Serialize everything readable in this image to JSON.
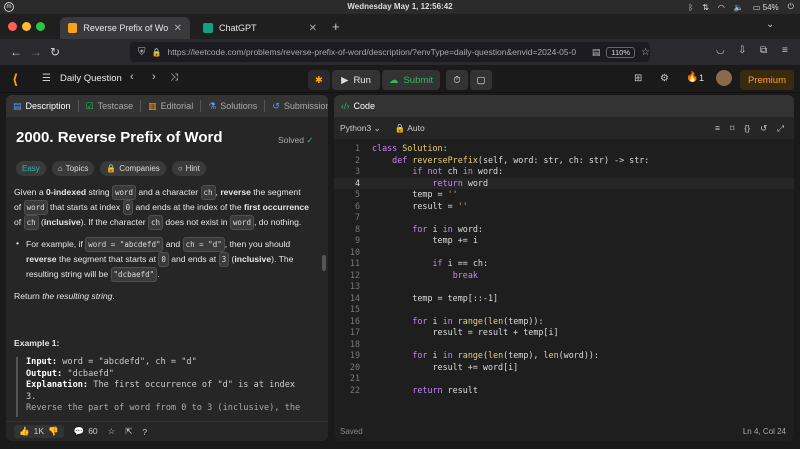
{
  "os": {
    "clock": "Wednesday May 1, 12:56:42",
    "battery": "54%"
  },
  "browser": {
    "tabs": [
      {
        "title": "Reverse Prefix of Word - Le",
        "active": true
      },
      {
        "title": "ChatGPT",
        "active": false
      }
    ],
    "new_tab": "+",
    "url": "https://leetcode.com/problems/reverse-prefix-of-word/description/?envType=daily-question&envid=2024-05-0",
    "zoom": "110%"
  },
  "lc_header": {
    "daily_label": "Daily Question",
    "run_label": "Run",
    "submit_label": "Submit",
    "streak_count": "1",
    "premium_label": "Premium"
  },
  "left_panel": {
    "tabs": [
      "Description",
      "Testcase",
      "Editorial",
      "Solutions",
      "Submissions"
    ],
    "title": "2000. Reverse Prefix of Word",
    "status": "Solved",
    "tags": {
      "difficulty": "Easy",
      "topics": "Topics",
      "companies": "Companies",
      "hint": "Hint"
    },
    "para1": {
      "a": "Given a ",
      "b": "0-indexed",
      "c": " string ",
      "d": "word",
      "e": " and a character ",
      "f": "ch",
      "g": ", ",
      "h": "reverse",
      "i": " the segment",
      "j": "of ",
      "k": "word",
      "l": " that starts at index ",
      "m": "0",
      "n": " and ends at the index of the ",
      "o": "first occurrence",
      "p": "of ",
      "q": "ch",
      "r": " (",
      "s": "inclusive",
      "t": "). If the character ",
      "u": "ch",
      "v": " does not exist in ",
      "w": "word",
      "x": ", do nothing."
    },
    "bullet": {
      "a": "For example, if ",
      "b": "word = \"abcdefd\"",
      "c": " and ",
      "d": "ch = \"d\"",
      "e": ", then you should",
      "f": "reverse",
      "g": " the segment that starts at ",
      "h": "0",
      "i": " and ends at ",
      "j": "3",
      "k": " (",
      "l": "inclusive",
      "m": "). The",
      "n": "resulting string will be ",
      "o": "\"dcbaefd\"",
      "p": "."
    },
    "return_text": {
      "a": "Return ",
      "b": "the resulting string",
      "c": "."
    },
    "example_title": "Example 1:",
    "example_lines": [
      {
        "label": "Input:",
        "value": " word = \"abcdefd\", ch = \"d\""
      },
      {
        "label": "Output:",
        "value": " \"dcbaefd\""
      },
      {
        "label": "Explanation:",
        "value": " The first occurrence of \"d\" is at index"
      },
      {
        "label": "",
        "value": "3."
      },
      {
        "label": "",
        "value": "Reverse the part of word from 0 to 3 (inclusive), the"
      }
    ],
    "footer": {
      "likes": "1K",
      "comments": "60"
    }
  },
  "right_panel": {
    "tab": "Code",
    "language": "Python3",
    "mode": "Auto",
    "status": "Saved",
    "cursor": "Ln 4, Col 24",
    "code": [
      {
        "n": "1",
        "t": [
          [
            "k1",
            "class "
          ],
          [
            "fn",
            "Solution"
          ],
          [
            "txt",
            ":"
          ]
        ]
      },
      {
        "n": "2",
        "t": [
          [
            "txt",
            "    "
          ],
          [
            "k1",
            "def "
          ],
          [
            "fn",
            "reversePrefix"
          ],
          [
            "txt",
            "(self, word: str, ch: str) -> str:"
          ]
        ]
      },
      {
        "n": "3",
        "t": [
          [
            "txt",
            "        "
          ],
          [
            "k1",
            "if not "
          ],
          [
            "txt",
            "ch "
          ],
          [
            "k1",
            "in "
          ],
          [
            "txt",
            "word:"
          ]
        ]
      },
      {
        "n": "4",
        "t": [
          [
            "txt",
            "            "
          ],
          [
            "k1",
            "return "
          ],
          [
            "txt",
            "word"
          ]
        ]
      },
      {
        "n": "5",
        "t": [
          [
            "txt",
            "        temp = "
          ],
          [
            "str",
            "''"
          ]
        ]
      },
      {
        "n": "6",
        "t": [
          [
            "txt",
            "        result = "
          ],
          [
            "str",
            "''"
          ]
        ]
      },
      {
        "n": "7",
        "t": [
          [
            "txt",
            ""
          ]
        ]
      },
      {
        "n": "8",
        "t": [
          [
            "txt",
            "        "
          ],
          [
            "k1",
            "for "
          ],
          [
            "txt",
            "i "
          ],
          [
            "k1",
            "in "
          ],
          [
            "txt",
            "word:"
          ]
        ]
      },
      {
        "n": "9",
        "t": [
          [
            "txt",
            "            temp += i"
          ]
        ]
      },
      {
        "n": "10",
        "t": [
          [
            "txt",
            ""
          ]
        ]
      },
      {
        "n": "11",
        "t": [
          [
            "txt",
            "            "
          ],
          [
            "k1",
            "if "
          ],
          [
            "txt",
            "i == ch:"
          ]
        ]
      },
      {
        "n": "12",
        "t": [
          [
            "txt",
            "                "
          ],
          [
            "k1",
            "break"
          ]
        ]
      },
      {
        "n": "13",
        "t": [
          [
            "txt",
            ""
          ]
        ]
      },
      {
        "n": "14",
        "t": [
          [
            "txt",
            "        temp = temp[::-1]"
          ]
        ]
      },
      {
        "n": "15",
        "t": [
          [
            "txt",
            ""
          ]
        ]
      },
      {
        "n": "16",
        "t": [
          [
            "txt",
            "        "
          ],
          [
            "k1",
            "for "
          ],
          [
            "txt",
            "i "
          ],
          [
            "k1",
            "in "
          ],
          [
            "fn",
            "range"
          ],
          [
            "txt",
            "("
          ],
          [
            "fn",
            "len"
          ],
          [
            "txt",
            "(temp)):"
          ]
        ]
      },
      {
        "n": "17",
        "t": [
          [
            "txt",
            "            result = result + temp[i]"
          ]
        ]
      },
      {
        "n": "18",
        "t": [
          [
            "txt",
            ""
          ]
        ]
      },
      {
        "n": "19",
        "t": [
          [
            "txt",
            "        "
          ],
          [
            "k1",
            "for "
          ],
          [
            "txt",
            "i "
          ],
          [
            "k1",
            "in "
          ],
          [
            "fn",
            "range"
          ],
          [
            "txt",
            "("
          ],
          [
            "fn",
            "len"
          ],
          [
            "txt",
            "(temp), "
          ],
          [
            "fn",
            "len"
          ],
          [
            "txt",
            "(word)):"
          ]
        ]
      },
      {
        "n": "20",
        "t": [
          [
            "txt",
            "            result += word[i]"
          ]
        ]
      },
      {
        "n": "21",
        "t": [
          [
            "txt",
            ""
          ]
        ]
      },
      {
        "n": "22",
        "t": [
          [
            "txt",
            "        "
          ],
          [
            "k1",
            "return "
          ],
          [
            "txt",
            "result"
          ]
        ]
      }
    ]
  },
  "colors": {
    "accent_green": "#2cbb5d",
    "easy": "#2db7a3",
    "premium": "#ffa116"
  }
}
